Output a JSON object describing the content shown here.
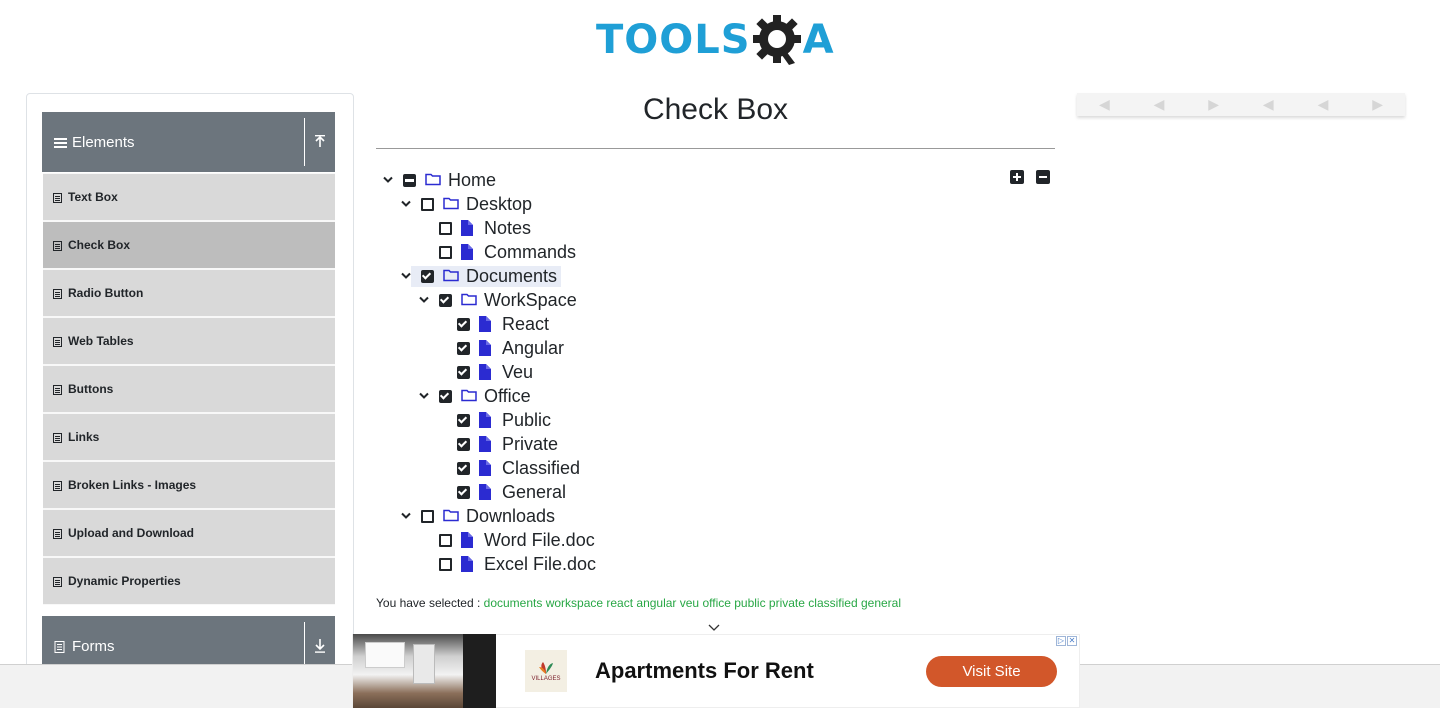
{
  "brand": {
    "logo_text": "TOOLS",
    "logo_suffix": "A",
    "accent": "#1f9fd6"
  },
  "sidebar": {
    "groups": [
      {
        "label": "Elements",
        "icon": "chevron-up-icon"
      },
      {
        "label": "Forms",
        "icon": "chevron-down-icon"
      }
    ],
    "items": [
      {
        "label": "Text Box"
      },
      {
        "label": "Check Box",
        "active": true
      },
      {
        "label": "Radio Button"
      },
      {
        "label": "Web Tables"
      },
      {
        "label": "Buttons"
      },
      {
        "label": "Links"
      },
      {
        "label": "Broken Links - Images"
      },
      {
        "label": "Upload and Download"
      },
      {
        "label": "Dynamic Properties"
      }
    ]
  },
  "main": {
    "title": "Check Box",
    "tree": [
      {
        "label": "Home",
        "type": "folder",
        "state": "half",
        "expanded": true
      },
      {
        "label": "Desktop",
        "type": "folder",
        "state": "empty",
        "expanded": true
      },
      {
        "label": "Notes",
        "type": "file",
        "state": "empty"
      },
      {
        "label": "Commands",
        "type": "file",
        "state": "empty"
      },
      {
        "label": "Documents",
        "type": "folder",
        "state": "checked",
        "expanded": true,
        "focused": true
      },
      {
        "label": "WorkSpace",
        "type": "folder",
        "state": "checked",
        "expanded": true
      },
      {
        "label": "React",
        "type": "file",
        "state": "checked"
      },
      {
        "label": "Angular",
        "type": "file",
        "state": "checked"
      },
      {
        "label": "Veu",
        "type": "file",
        "state": "checked"
      },
      {
        "label": "Office",
        "type": "folder",
        "state": "checked",
        "expanded": true
      },
      {
        "label": "Public",
        "type": "file",
        "state": "checked"
      },
      {
        "label": "Private",
        "type": "file",
        "state": "checked"
      },
      {
        "label": "Classified",
        "type": "file",
        "state": "checked"
      },
      {
        "label": "General",
        "type": "file",
        "state": "checked"
      },
      {
        "label": "Downloads",
        "type": "folder",
        "state": "empty",
        "expanded": true
      },
      {
        "label": "Word File.doc",
        "type": "file",
        "state": "empty"
      },
      {
        "label": "Excel File.doc",
        "type": "file",
        "state": "empty"
      }
    ],
    "result_prefix": "You have selected :",
    "result_values": "documents workspace react angular veu office public private classified general",
    "result_color": "#28a745"
  },
  "ad": {
    "title": "Apartments For Rent",
    "button": "Visit Site",
    "button_color": "#d2572a",
    "logo_text": "VILLAGES"
  }
}
